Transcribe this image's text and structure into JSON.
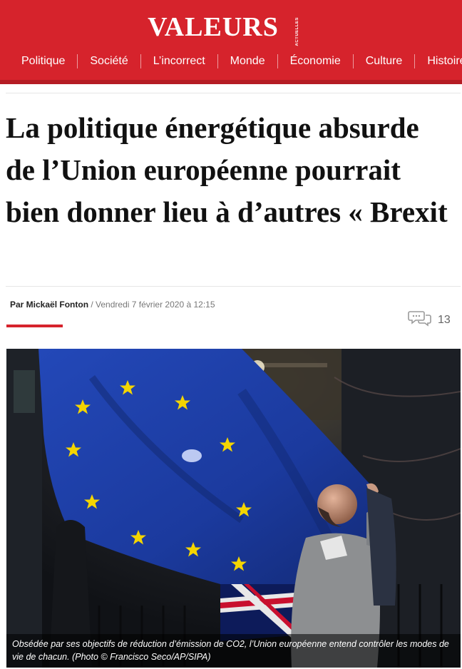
{
  "header": {
    "logo": "VALEURS",
    "logo_sub": "ACTUELLES",
    "nav": [
      "Politique",
      "Société",
      "L’incorrect",
      "Monde",
      "Économie",
      "Culture",
      "Histoire"
    ]
  },
  "article": {
    "title": "La politique énergétique absurde de l’Union européenne pourrait bien donner lieu à d’autres « Brexit",
    "author": "Par Mickaël Fonton",
    "date": "/ Vendredi 7 février 2020 à 12:15",
    "comment_count": "13",
    "image": {
      "caption": "Obsédée par ses objectifs de réduction d’émission de CO2, l’Union européenne entend contrôler les modes de vie de chacun. (Photo © Francisco Seco/AP/SIPA)"
    }
  },
  "colors": {
    "brand": "#d6232c",
    "flag_blue": "#1b3fa8",
    "star": "#f4d500"
  }
}
